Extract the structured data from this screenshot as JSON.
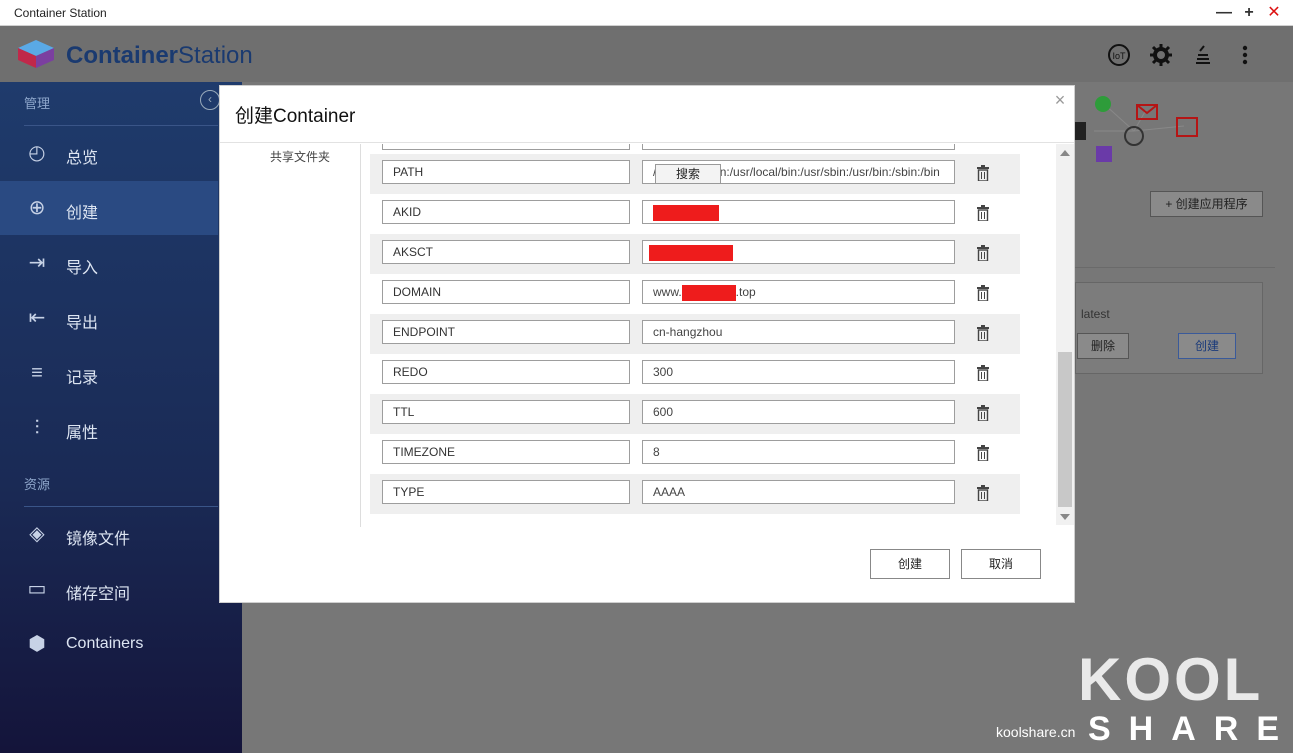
{
  "window": {
    "title": "Container Station",
    "minimize": "—",
    "maximize": "+",
    "close": "✕"
  },
  "app": {
    "brand_bold": "Container",
    "brand_light": "Station"
  },
  "header_icons": [
    "iot-icon",
    "gear-icon",
    "stack-icon",
    "more-vert-icon"
  ],
  "header": {
    "iot_label": "IoT"
  },
  "sidebar": {
    "section_manage": "管理",
    "section_resources": "资源",
    "items": [
      {
        "label": "总览",
        "icon": "dashboard-icon",
        "glyph": "◴"
      },
      {
        "label": "创建",
        "icon": "plus-icon",
        "glyph": "⊕",
        "active": true
      },
      {
        "label": "导入",
        "icon": "import-icon",
        "glyph": "⇥"
      },
      {
        "label": "导出",
        "icon": "export-icon",
        "glyph": "⇤"
      },
      {
        "label": "记录",
        "icon": "log-icon",
        "glyph": "≡"
      },
      {
        "label": "属性",
        "icon": "sliders-icon",
        "glyph": "⫶"
      }
    ],
    "resource_items": [
      {
        "label": "镜像文件",
        "icon": "layers-icon",
        "glyph": "◈"
      },
      {
        "label": "储存空间",
        "icon": "database-icon",
        "glyph": "▭"
      },
      {
        "label": "Containers",
        "icon": "cube-icon",
        "glyph": "⬢"
      }
    ]
  },
  "background": {
    "create_app_button": "创建应用程序",
    "card_tag": "latest",
    "delete_button": "删除",
    "create_button": "创建"
  },
  "dialog": {
    "title": "创建Container",
    "close": "×",
    "side_label": "共享文件夹",
    "search_button": "搜索",
    "env": [
      {
        "key": "PATH",
        "value": "/usr/local/sbin:/usr/local/bin:/usr/sbin:/usr/bin:/sbin:/bin"
      },
      {
        "key": "AKID",
        "value": "",
        "redacted": true
      },
      {
        "key": "AKSCT",
        "value": "",
        "redacted": true
      },
      {
        "key": "DOMAIN",
        "value_prefix": "www.",
        "value_suffix": ".top",
        "redacted": true
      },
      {
        "key": "ENDPOINT",
        "value": "cn-hangzhou"
      },
      {
        "key": "REDO",
        "value": "300"
      },
      {
        "key": "TTL",
        "value": "600"
      },
      {
        "key": "TIMEZONE",
        "value": "8"
      },
      {
        "key": "TYPE",
        "value": "AAAA"
      }
    ],
    "ok_button": "创建",
    "cancel_button": "取消"
  },
  "watermark": {
    "site": "koolshare.cn",
    "big": "KOOL",
    "sub": "SHARE"
  },
  "colors": {
    "sidebar": "#1f3b6c",
    "accent": "#1a3a70",
    "redaction": "#ee1c1c",
    "close_red": "#dd1111"
  }
}
